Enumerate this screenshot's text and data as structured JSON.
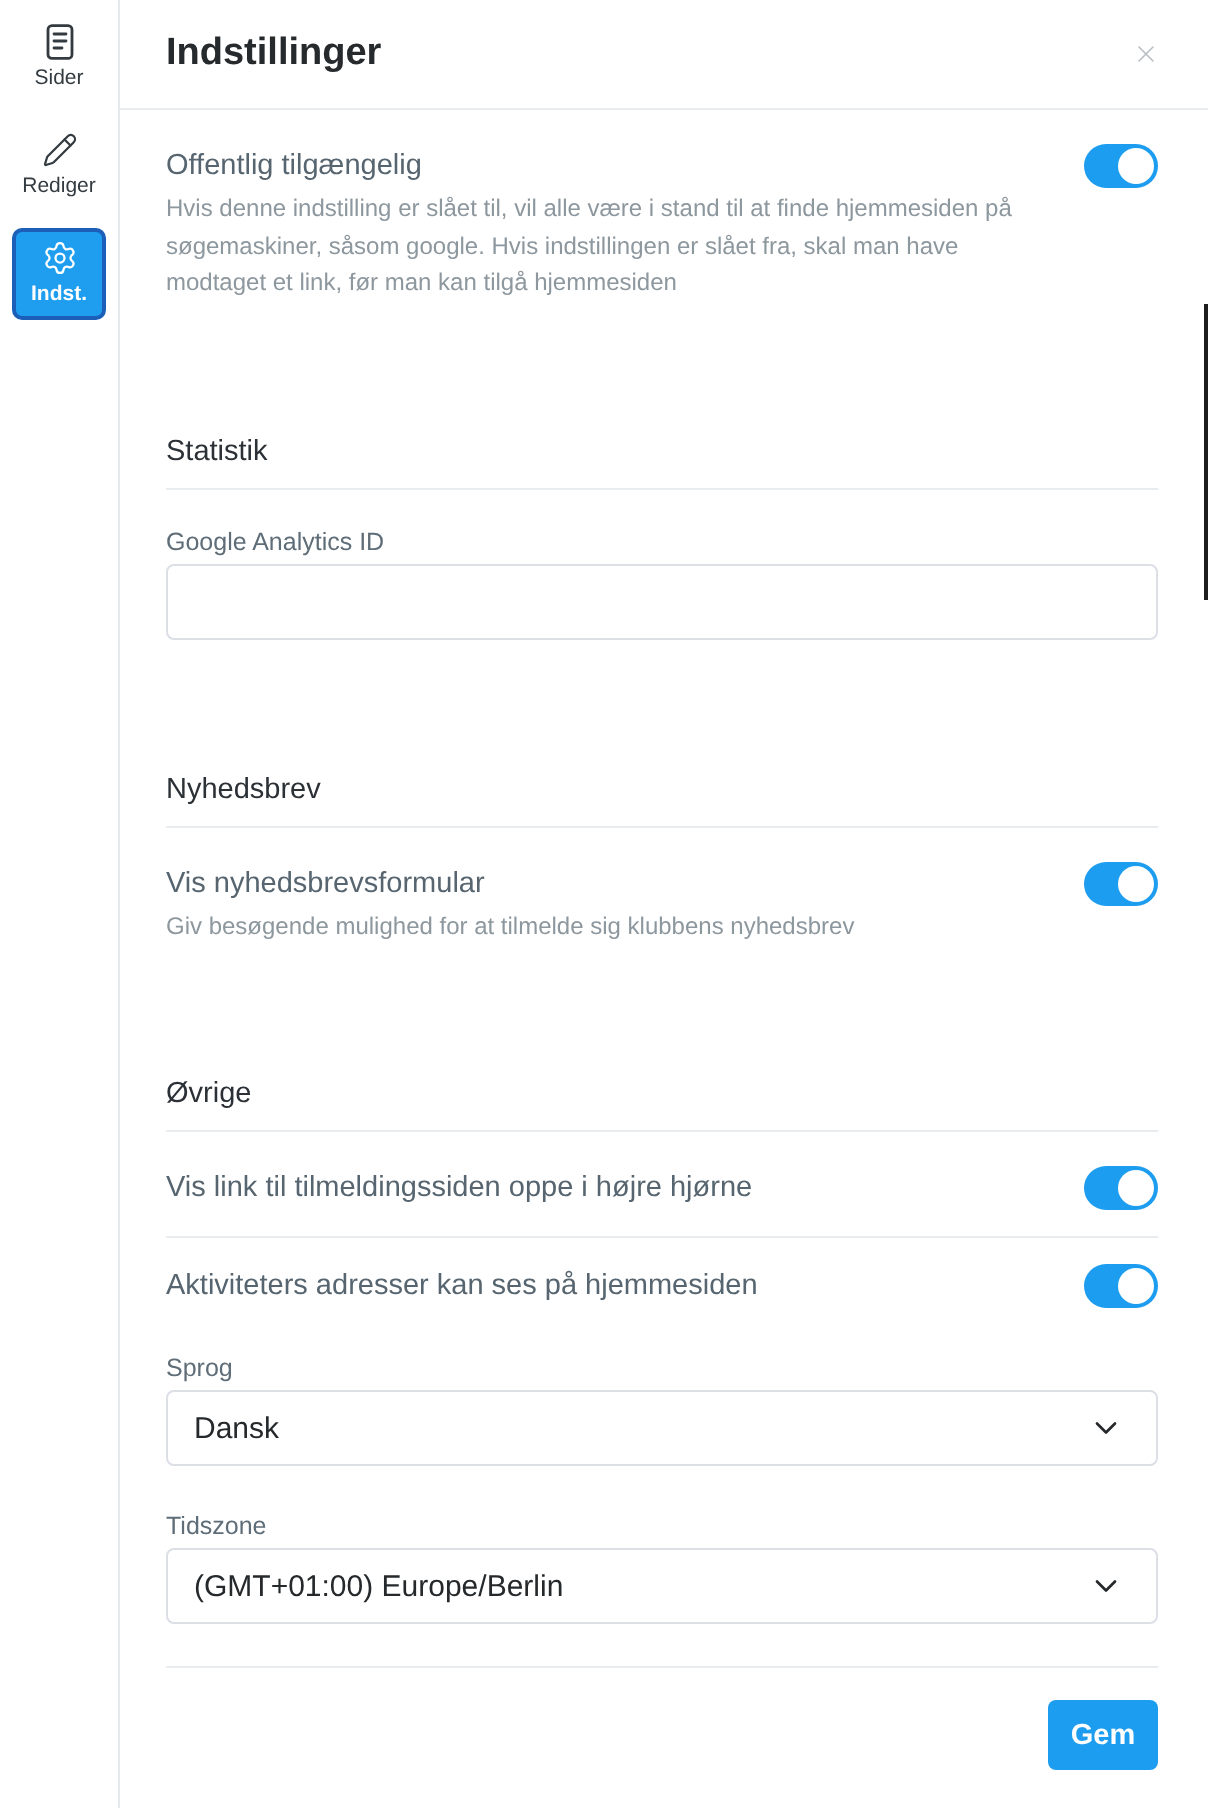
{
  "sidebar": {
    "items": [
      {
        "label": "Sider",
        "selected": false
      },
      {
        "label": "Rediger",
        "selected": false
      },
      {
        "label": "Indst.",
        "selected": true
      }
    ]
  },
  "panel": {
    "title": "Indstillinger"
  },
  "sections": [
    {
      "rows": [
        {
          "kind": "toggle",
          "label": "Offentlig tilgængelig",
          "description": "Hvis denne indstilling er slået til, vil alle være i stand til at finde hjemmesiden på søgemaskiner, såsom google. Hvis indstillingen er slået fra, skal man have modtaget et link, før man kan tilgå hjemmesiden",
          "on": true
        }
      ]
    },
    {
      "heading": "Statistik",
      "rows": [
        {
          "kind": "text_field",
          "label": "Google Analytics ID"
        }
      ]
    },
    {
      "heading": "Nyhedsbrev",
      "rows": [
        {
          "kind": "toggle",
          "label": "Vis nyhedsbrevsformular",
          "description": "Giv besøgende mulighed for at tilmelde sig klubbens nyhedsbrev",
          "on": true
        }
      ]
    },
    {
      "heading": "Øvrige",
      "rows": [
        {
          "kind": "toggle",
          "label": "Vis link til tilmeldingssiden oppe i højre hjørne",
          "on": true
        },
        {
          "kind": "toggle",
          "label": "Aktiviteters adresser kan ses på hjemmesiden",
          "on": true
        },
        {
          "kind": "select",
          "label": "Sprog",
          "value": "Dansk"
        },
        {
          "kind": "select",
          "label": "Tidszone",
          "value": "(GMT+01:00) Europe/Berlin"
        }
      ]
    }
  ],
  "save_button": "Gem"
}
